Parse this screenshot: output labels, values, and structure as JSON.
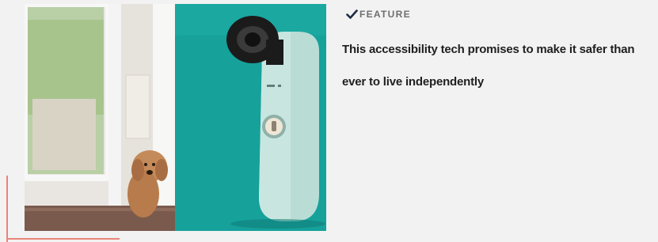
{
  "article": {
    "category_icon": "checkmark-icon",
    "category": "FEATURE",
    "headline": "This accessibility tech promises to make it safer than ever to live independently",
    "image_subject": "dog-door-device-photo"
  },
  "colors": {
    "accent": "#e8857a",
    "check": "#1f2a44",
    "kicker": "#6f6f6f",
    "headline": "#1f1f1f",
    "background": "#f2f2f2"
  }
}
